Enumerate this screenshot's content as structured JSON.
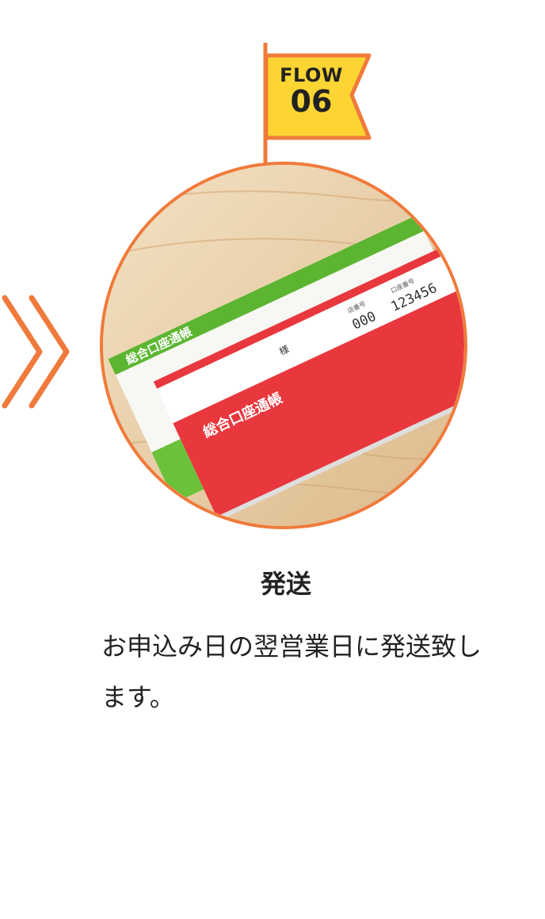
{
  "flag": {
    "word": "FLOW",
    "number": "06"
  },
  "step": {
    "title": "発送",
    "description": "お申込み日の翌営業日に発送致します。"
  },
  "image": {
    "passbook_title": "総合口座通帳",
    "field_sama": "様",
    "field_branch_label": "店番号",
    "field_branch_value": "000",
    "field_account_label": "口座番号",
    "field_account_value": "123456"
  },
  "colors": {
    "accent": "#f07a3b",
    "flag_fill": "#fcd533",
    "passbook_red": "#e8383d",
    "passbook_green": "#5cb531"
  }
}
